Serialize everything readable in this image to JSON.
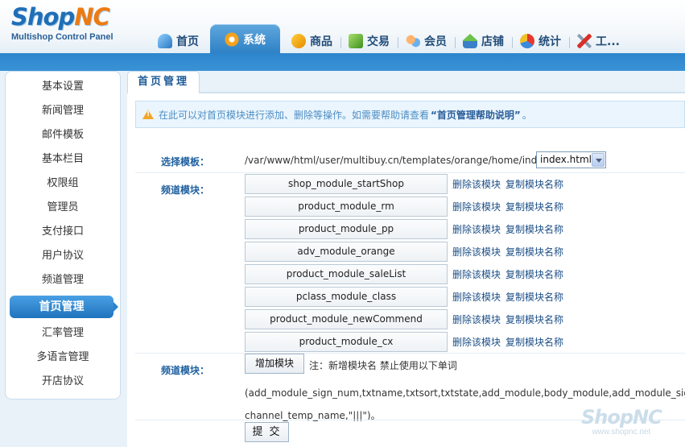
{
  "brand": {
    "logo_shop": "Shop",
    "logo_nc": "NC",
    "subtitle": "Multishop Control Panel"
  },
  "nav": {
    "items": [
      {
        "label": "首页",
        "icon": "home-icon"
      },
      {
        "label": "系统",
        "icon": "gear-icon",
        "active": true
      },
      {
        "label": "商品",
        "icon": "goods-icon"
      },
      {
        "label": "交易",
        "icon": "trade-icon"
      },
      {
        "label": "会员",
        "icon": "members-icon"
      },
      {
        "label": "店铺",
        "icon": "store-icon"
      },
      {
        "label": "统计",
        "icon": "stats-icon"
      },
      {
        "label": "工...",
        "icon": "tools-icon"
      }
    ]
  },
  "sidebar": {
    "items": [
      {
        "label": "基本设置"
      },
      {
        "label": "新闻管理"
      },
      {
        "label": "邮件模板"
      },
      {
        "label": "基本栏目"
      },
      {
        "label": "权限组"
      },
      {
        "label": "管理员"
      },
      {
        "label": "支付接口"
      },
      {
        "label": "用户协议"
      },
      {
        "label": "频道管理"
      },
      {
        "label": "首页管理",
        "active": true
      },
      {
        "label": "汇率管理"
      },
      {
        "label": "多语言管理"
      },
      {
        "label": "开店协议"
      }
    ]
  },
  "main": {
    "tab_title": "首页管理",
    "notice": {
      "text": "在此可以对首页模块进行添加、删除等操作。如需要帮助请查看",
      "link_text": "“首页管理帮助说明”",
      "end": "。"
    },
    "template": {
      "label": "选择模板：",
      "path": "/var/www/html/user/multibuy.cn/templates/orange/home/index_tpl/",
      "selected": "index.html"
    },
    "modules": {
      "label": "频道模块：",
      "delete_label": "删除该模块",
      "copy_label": "复制模块名称",
      "items": [
        "shop_module_startShop",
        "product_module_rm",
        "product_module_pp",
        "adv_module_orange",
        "product_module_saleList",
        "pclass_module_class",
        "product_module_newCommend",
        "product_module_cx"
      ]
    },
    "add": {
      "label": "频道模块：",
      "button": "增加模块",
      "note": "注：新增模块名 禁止使用以下单词",
      "words": "(add_module_sign_num,txtname,txtsort,txtstate,add_module,body_module,add_module_sign, channel_temp_name,\"|||\")。"
    },
    "submit": "提交"
  },
  "watermark": {
    "logo": "ShopNC",
    "url": "www.shopnc.net"
  }
}
